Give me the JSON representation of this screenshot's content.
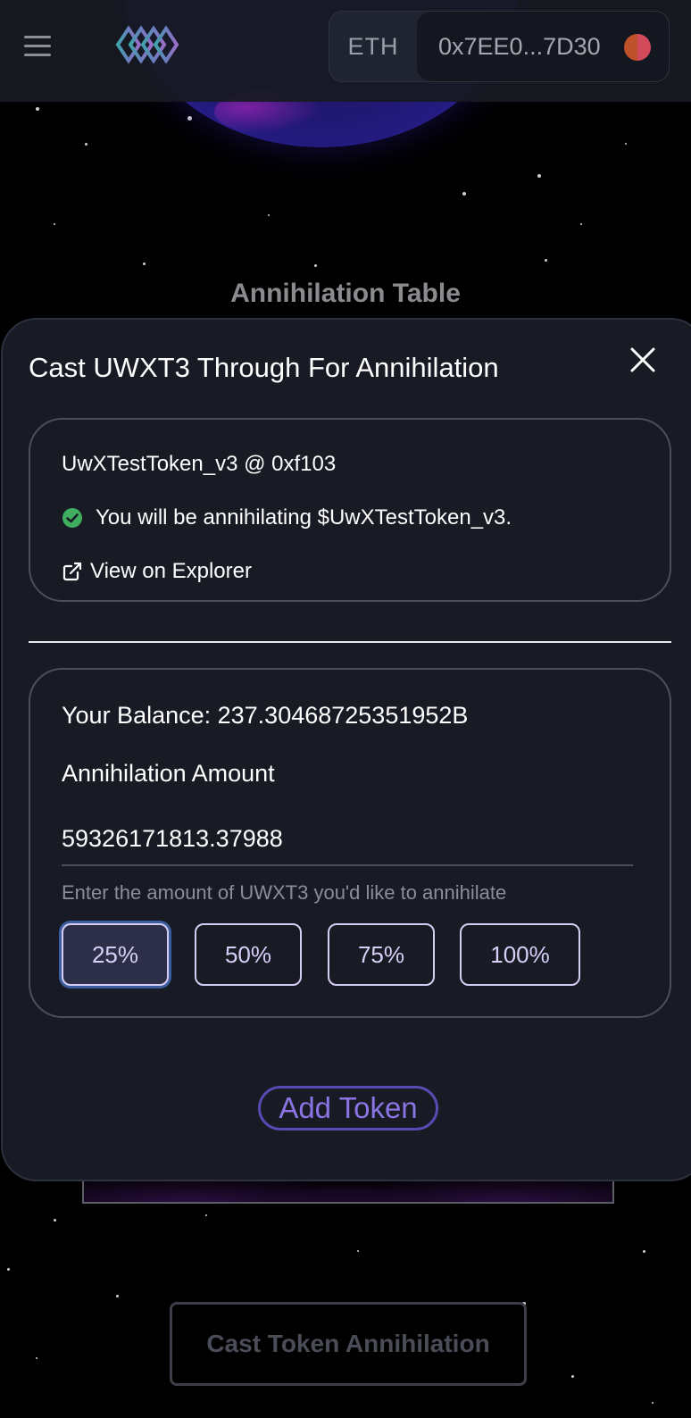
{
  "header": {
    "network": "ETH",
    "wallet_address": "0x7EE0...7D30"
  },
  "background": {
    "section_title": "Annihilation Table",
    "cast_button_label": "Cast Token Annihilation"
  },
  "modal": {
    "title": "Cast UWXT3 Through For Annihilation",
    "token": {
      "name": "UwXTestToken_v3 @ 0xf103",
      "verification_text": "You will be annihilating $UwXTestToken_v3.",
      "explorer_link": "View on Explorer"
    },
    "amount": {
      "balance": "Your Balance: 237.30468725351952B",
      "label": "Annihilation Amount",
      "value": "59326171813.37988",
      "helper": "Enter the amount of UWXT3 you'd like to annihilate",
      "percent_options": [
        "25%",
        "50%",
        "75%",
        "100%"
      ],
      "selected": "25%"
    },
    "add_token_label": "Add Token"
  },
  "colors": {
    "accent": "#8b74e3",
    "modal_bg": "#181a24",
    "success": "#3fae5f"
  }
}
